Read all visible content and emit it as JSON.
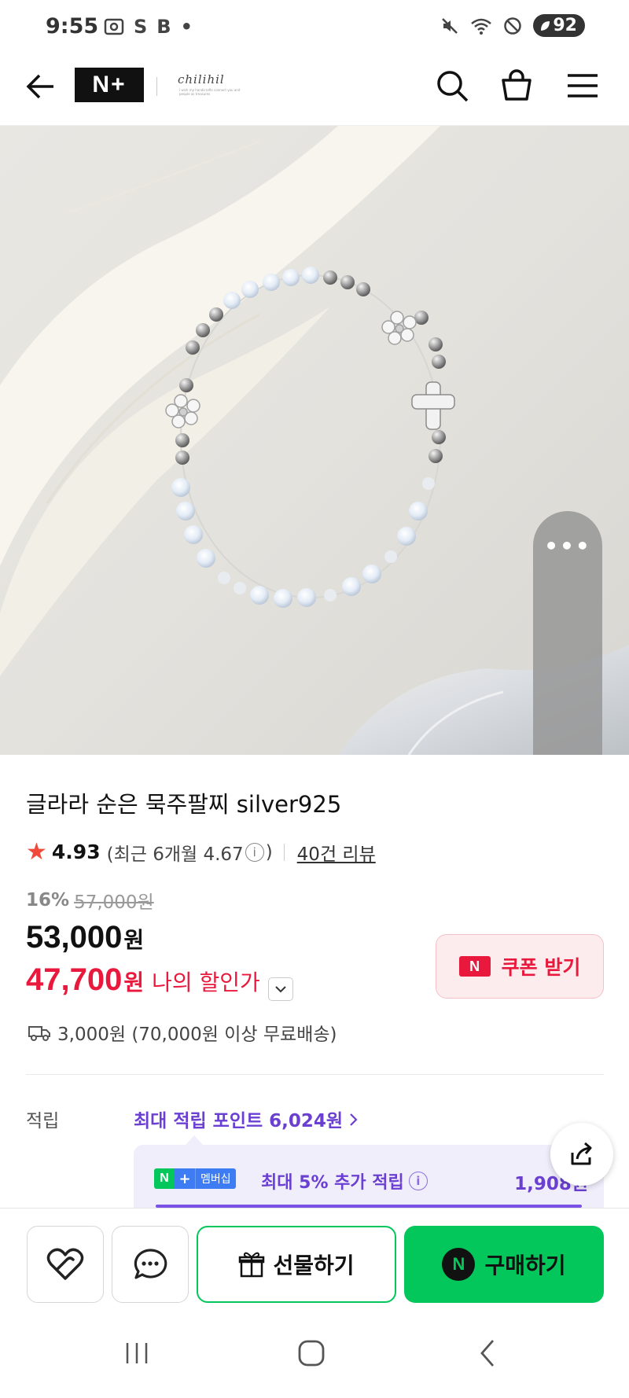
{
  "status_bar": {
    "time": "9:55",
    "left_icons": [
      "screenshot-icon",
      "S",
      "B",
      "•"
    ],
    "battery": "92"
  },
  "header": {
    "logo": "N+",
    "brand": "chilihil",
    "brand_sub": "I wish my handicrafts connect you and people as treasures"
  },
  "product": {
    "title": "글라라 순은 묵주팔찌 silver925",
    "rating": "4.93",
    "recent_rating_prefix": "(최근 6개월 4.67",
    "recent_rating_suffix": ")",
    "review_count": "40건 리뷰",
    "discount_pct": "16%",
    "original_price": "57,000원",
    "sale_price": "53,000",
    "sale_price_unit": "원",
    "my_price": "47,700",
    "my_price_unit": "원",
    "my_price_label": "나의 할인가",
    "coupon_badge": "N",
    "coupon_label": "쿠폰 받기",
    "shipping": "3,000원 (70,000원 이상 무료배송)"
  },
  "points": {
    "label": "적립",
    "max_points": "최대 적립 포인트 6,024원",
    "membership_n": "N",
    "membership_plus": "+",
    "membership_text": "멤버십",
    "membership_desc": "최대 5% 추가 적립",
    "membership_amount": "1,908원"
  },
  "floating_panel": {
    "menu": "•••",
    "music": "♪"
  },
  "actions": {
    "gift_label": "선물하기",
    "buy_badge": "N",
    "buy_label": "구매하기"
  },
  "colors": {
    "accent_green": "#03c75a",
    "price_red": "#e8193c",
    "points_purple": "#6a3fd1"
  }
}
